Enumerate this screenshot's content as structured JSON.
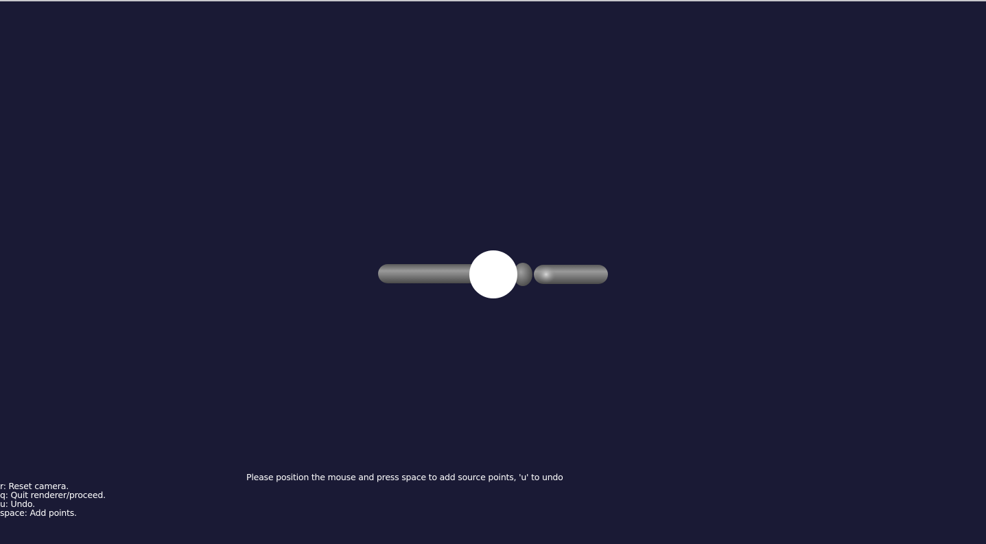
{
  "viewer": {
    "background_color": "#1a1a35",
    "instruction": "Please position the mouse and press space to add source points, 'u' to undo",
    "help": [
      "r: Reset camera.",
      "q: Quit renderer/proceed.",
      "u: Undo.",
      "space: Add points."
    ]
  },
  "scene": {
    "mesh_color": "#8a8a8a",
    "marker_color": "#ffffff"
  }
}
